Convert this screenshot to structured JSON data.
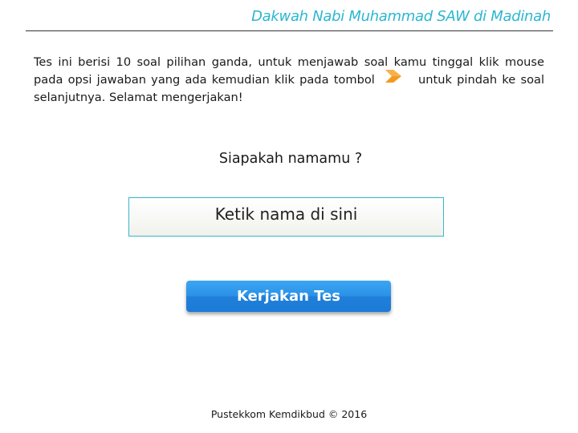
{
  "header": {
    "title": "Dakwah Nabi Muhammad SAW di Madinah"
  },
  "instructions": {
    "text_before_icon": "Tes ini berisi 10 soal pilihan ganda, untuk menjawab soal kamu tinggal klik mouse pada opsi jawaban yang ada kemudian klik pada tombol",
    "icon": "next-arrow-icon",
    "text_after_icon": "untuk pindah ke soal selanjutnya. Selamat mengerjakan!"
  },
  "question": {
    "label": "Siapakah namamu ?"
  },
  "name_input": {
    "placeholder": "Ketik nama di sini",
    "value": ""
  },
  "start_button": {
    "label": "Kerjakan Tes"
  },
  "footer": {
    "text": "Pustekkom Kemdikbud © 2016"
  },
  "colors": {
    "accent": "#2bb7cf",
    "button": "#2b92e8",
    "arrow": "#f39a1e"
  }
}
